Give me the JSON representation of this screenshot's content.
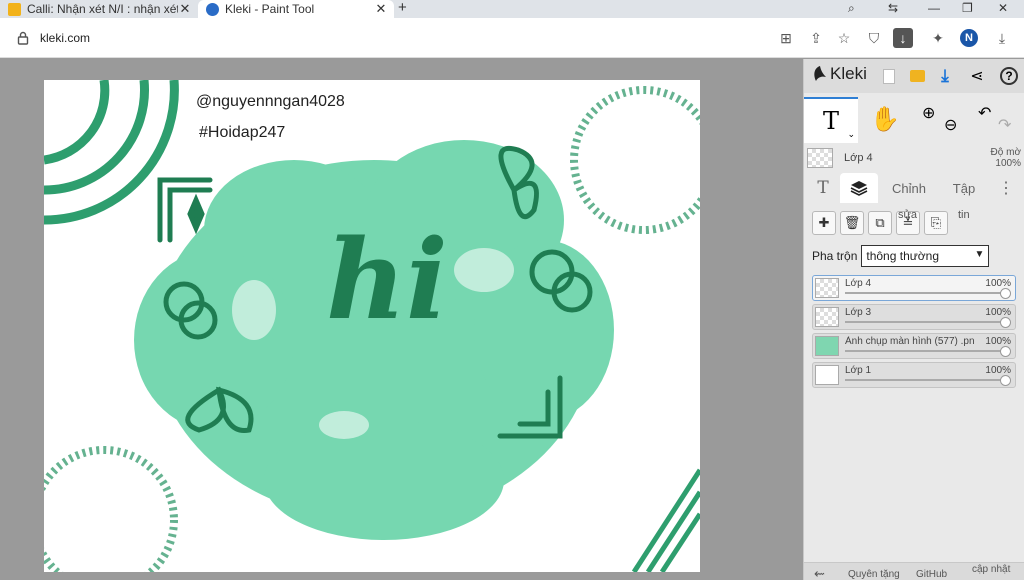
{
  "browser": {
    "tabs": [
      {
        "title": "Calli: Nhận xét N/I : nhận xét",
        "active": false
      },
      {
        "title": "Kleki - Paint Tool",
        "active": true
      }
    ],
    "new_tab": "+",
    "address": "kleki.com",
    "profile_initial": "N"
  },
  "canvas": {
    "handle": "@nguyennngan4028",
    "hashtag": "#Hoidap247",
    "center_text": "hi",
    "accent_color": "#2e9e6e",
    "blob_color": "#5fd1a3"
  },
  "panel": {
    "logo": "Kleki",
    "current_layer": "Lớp 4",
    "opacity_label": "Độ mờ",
    "opacity_value": "100%",
    "tabs": [
      "T",
      "layers",
      "Chỉnh",
      "Tập"
    ],
    "edit_label": "sửa",
    "info_label": "tin",
    "blend_label": "Pha trộn",
    "blend_value": "thông thường",
    "layers": [
      {
        "name": "Lớp 4",
        "opacity": "100%",
        "active": true
      },
      {
        "name": "Lớp 3",
        "opacity": "100%",
        "active": false
      },
      {
        "name": "Ảnh chụp màn hình (577) .pn",
        "opacity": "100%",
        "active": false
      },
      {
        "name": "Lớp 1",
        "opacity": "100%",
        "active": false
      }
    ],
    "footer": {
      "donate": "Quyên tặng",
      "github": "GitHub",
      "update": "cập nhật"
    }
  }
}
